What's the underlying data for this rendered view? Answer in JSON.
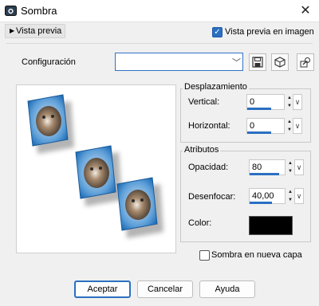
{
  "window": {
    "title": "Sombra",
    "close_glyph": "✕"
  },
  "preview": {
    "toggle_label": "Vista previa",
    "checkbox_label": "Vista previa en imagen",
    "checkbox_checked": true
  },
  "config": {
    "label": "Configuración",
    "value": ""
  },
  "icons": {
    "save": "save-icon",
    "reset": "reset-icon",
    "preset": "preset-icon"
  },
  "offset": {
    "title": "Desplazamiento",
    "vertical_label": "Vertical:",
    "vertical_value": "0",
    "horizontal_label": "Horizontal:",
    "horizontal_value": "0"
  },
  "attributes": {
    "title": "Atributos",
    "opacity_label": "Opacidad:",
    "opacity_value": "80",
    "blur_label": "Desenfocar:",
    "blur_value": "40,00",
    "color_label": "Color:",
    "color_value": "#000000"
  },
  "options": {
    "shadow_new_layer_label": "Sombra en nueva capa",
    "shadow_new_layer_checked": false
  },
  "buttons": {
    "ok": "Aceptar",
    "cancel": "Cancelar",
    "help": "Ayuda"
  },
  "colors": {
    "accent": "#2b6fc1"
  }
}
